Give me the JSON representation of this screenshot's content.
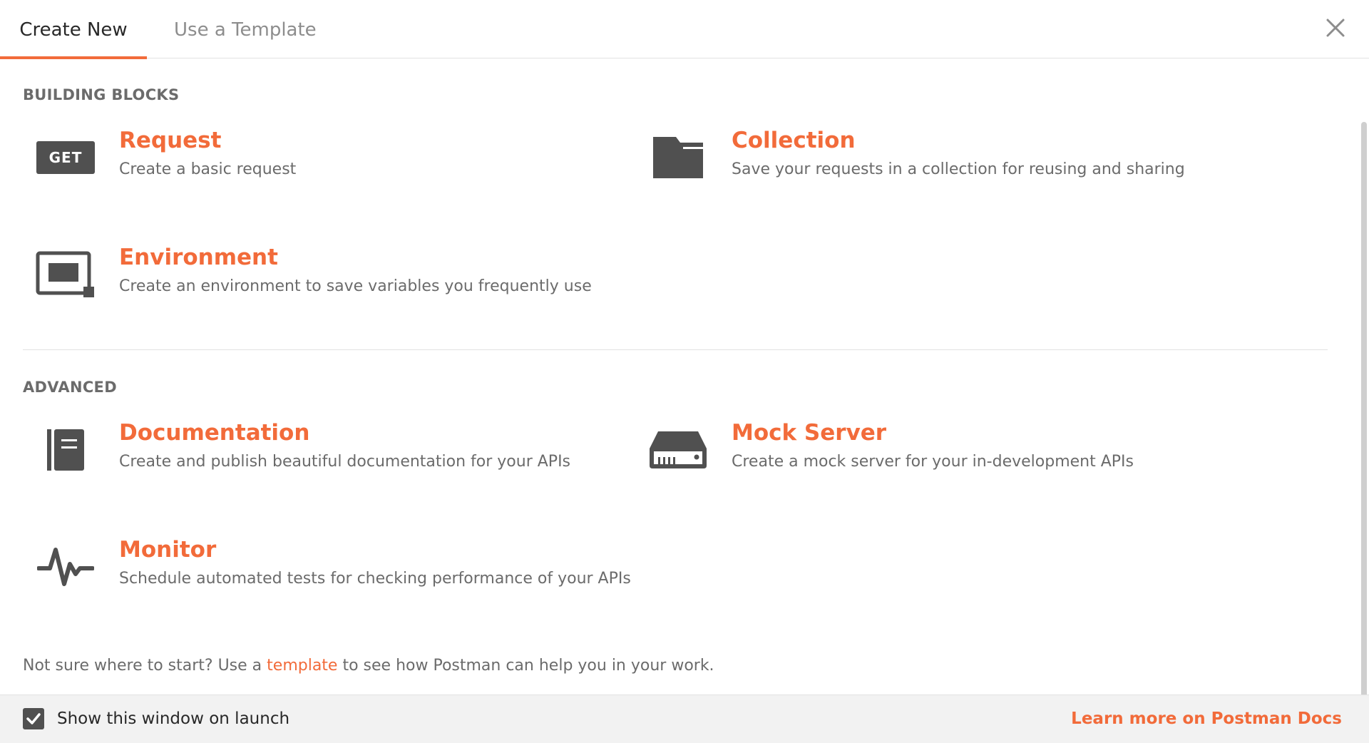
{
  "tabs": [
    {
      "label": "Create New",
      "active": true
    },
    {
      "label": "Use a Template",
      "active": false
    }
  ],
  "close_icon": "close-icon",
  "building_blocks": {
    "heading": "BUILDING BLOCKS",
    "items": [
      {
        "title": "Request",
        "description": "Create a basic request",
        "icon": "get-badge-icon",
        "badge": "GET"
      },
      {
        "title": "Collection",
        "description": "Save your requests in a collection for reusing and sharing",
        "icon": "folder-icon"
      },
      {
        "title": "Environment",
        "description": "Create an environment to save variables you frequently use",
        "icon": "environment-icon"
      }
    ]
  },
  "advanced": {
    "heading": "ADVANCED",
    "items": [
      {
        "title": "Documentation",
        "description": "Create and publish beautiful documentation for your APIs",
        "icon": "documentation-icon"
      },
      {
        "title": "Mock Server",
        "description": "Create a mock server for your in-development APIs",
        "icon": "server-icon"
      },
      {
        "title": "Monitor",
        "description": "Schedule automated tests for checking performance of your APIs",
        "icon": "pulse-icon"
      }
    ]
  },
  "hint": {
    "before": "Not sure where to start? Use a ",
    "link": "template",
    "after": " to see how Postman can help you in your work."
  },
  "footer": {
    "checkbox_label": "Show this window on launch",
    "checked": true,
    "docs_link": "Learn more on Postman Docs"
  },
  "colors": {
    "accent": "#f26b3a",
    "icon": "#505050",
    "text": "#6b6b6b"
  }
}
